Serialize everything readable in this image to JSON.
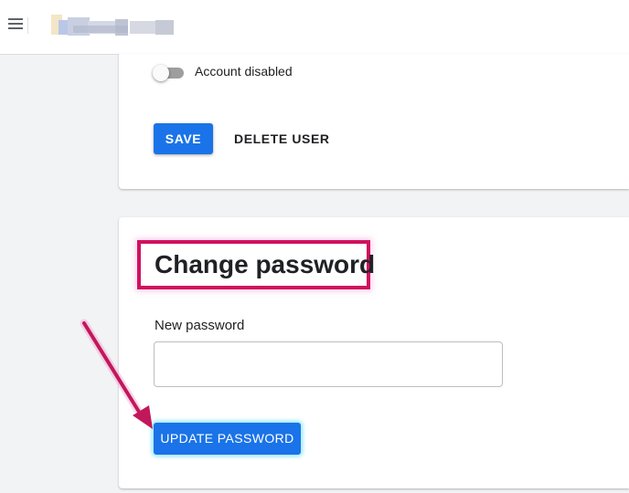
{
  "header": {
    "menu_icon": "hamburger-menu-icon",
    "logo": "blurred-logo"
  },
  "account_card": {
    "toggle": {
      "label": "Account disabled",
      "checked": false
    },
    "save_label": "SAVE",
    "delete_label": "DELETE USER"
  },
  "password_card": {
    "title": "Change password",
    "field_label": "New password",
    "field_value": "",
    "update_label": "UPDATE PASSWORD"
  },
  "annotations": {
    "highlight_color": "#d0115e",
    "arrow_color": "#c2185b",
    "arrow_icon": "pointer-arrow-icon"
  },
  "colors": {
    "primary": "#1a73e8",
    "background": "#f1f3f4"
  }
}
